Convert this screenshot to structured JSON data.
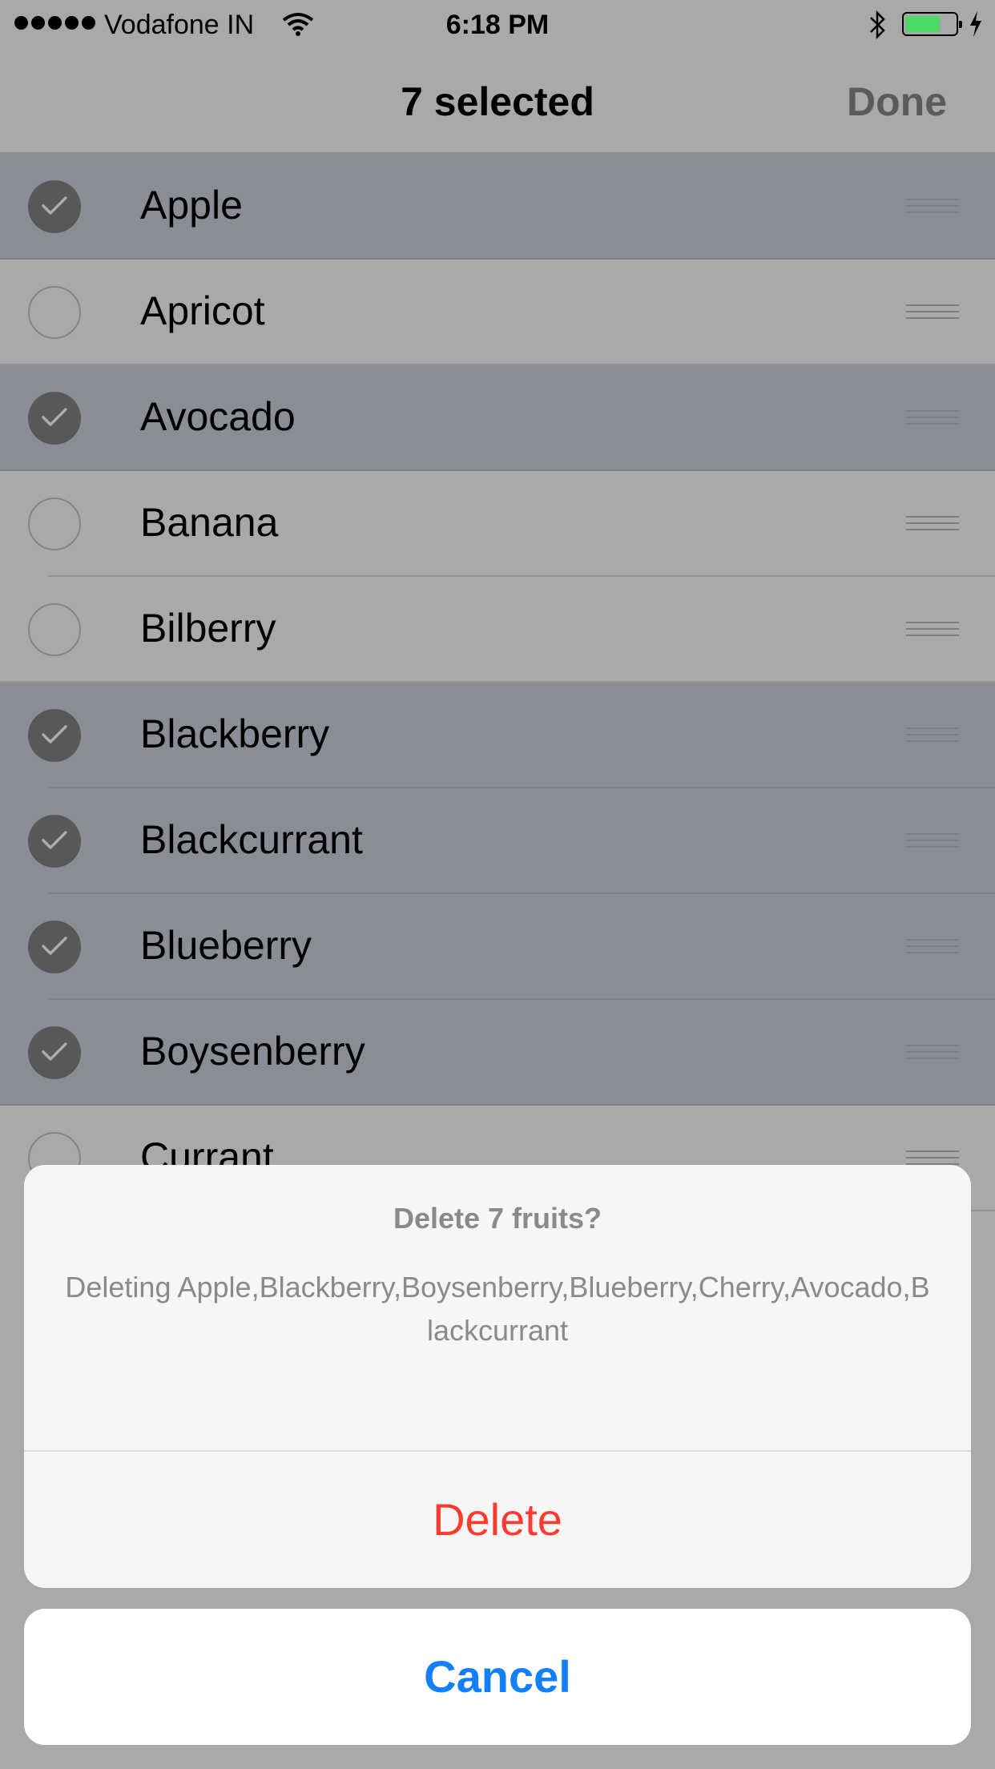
{
  "status_bar": {
    "carrier": "Vodafone IN",
    "time": "6:18 PM",
    "battery_color": "#4cd964"
  },
  "nav": {
    "title": "7 selected",
    "done_label": "Done"
  },
  "list": {
    "items": [
      {
        "label": "Apple",
        "selected": true
      },
      {
        "label": "Apricot",
        "selected": false
      },
      {
        "label": "Avocado",
        "selected": true
      },
      {
        "label": "Banana",
        "selected": false
      },
      {
        "label": "Bilberry",
        "selected": false
      },
      {
        "label": "Blackberry",
        "selected": true
      },
      {
        "label": "Blackcurrant",
        "selected": true
      },
      {
        "label": "Blueberry",
        "selected": true
      },
      {
        "label": "Boysenberry",
        "selected": true
      },
      {
        "label": "Currant",
        "selected": false
      }
    ]
  },
  "action_sheet": {
    "title": "Delete 7 fruits?",
    "message": "Deleting Apple,Blackberry,Boysenberry,Blueberry,Cherry,Avocado,Blackcurrant",
    "delete_label": "Delete",
    "cancel_label": "Cancel",
    "destructive_color": "#ff3b30",
    "accent_color": "#157efb"
  }
}
